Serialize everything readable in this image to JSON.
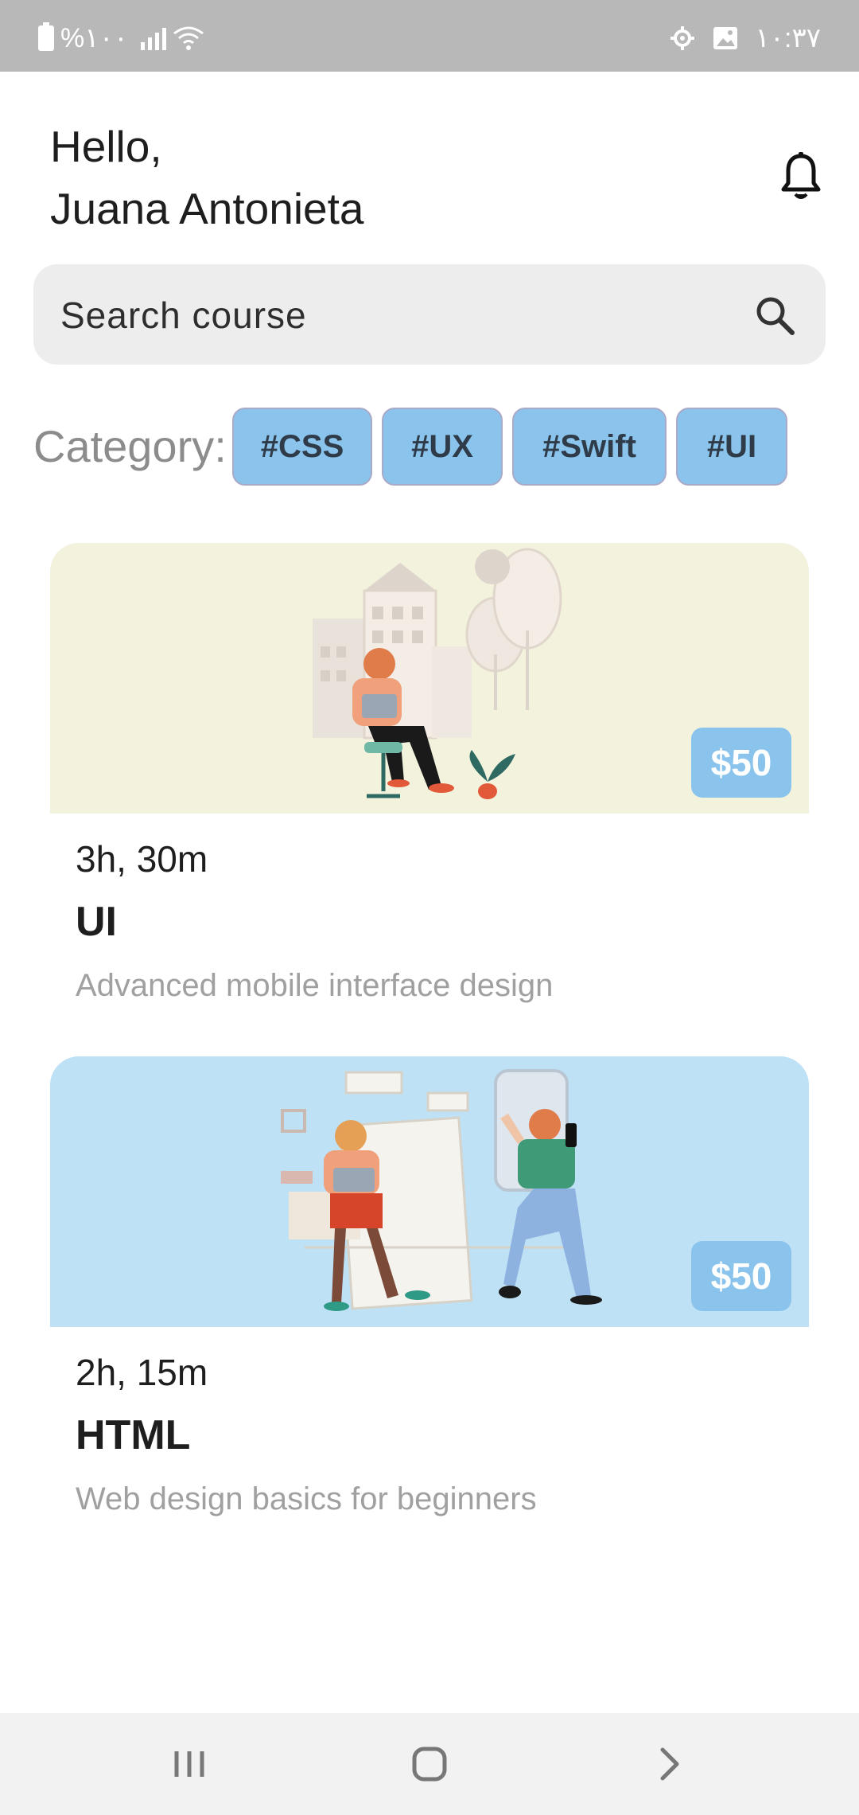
{
  "status_bar": {
    "battery": "%۱۰۰",
    "time": "۱۰:۳۷"
  },
  "header": {
    "greeting": "Hello,",
    "user_name": "Juana Antonieta"
  },
  "search": {
    "placeholder": "Search course"
  },
  "categories": {
    "label": "Category:",
    "chips": [
      "#CSS",
      "#UX",
      "#Swift",
      "#UI"
    ]
  },
  "courses": [
    {
      "duration": "3h, 30m",
      "title": "UI",
      "description": "Advanced mobile interface design",
      "price": "$50",
      "bg_color": "#f3f2dd"
    },
    {
      "duration": "2h, 15m",
      "title": "HTML",
      "description": "Web design basics for beginners",
      "price": "$50",
      "bg_color": "#bfe1f5"
    }
  ],
  "colors": {
    "accent": "#8ac4ec",
    "status_bar": "#b8b8b8"
  },
  "nav": {
    "icons": [
      "recent-apps-icon",
      "home-icon",
      "back-icon"
    ]
  }
}
